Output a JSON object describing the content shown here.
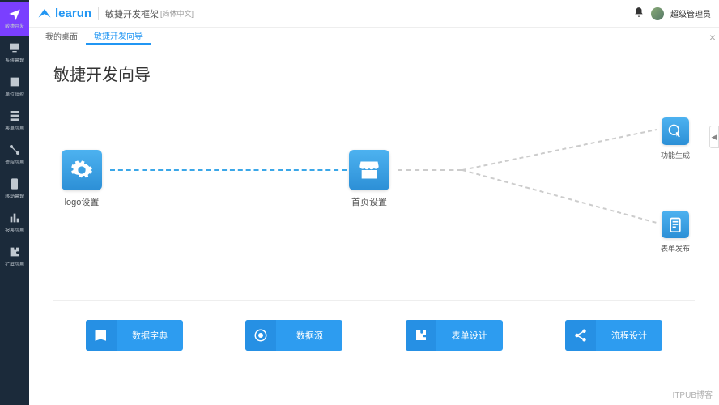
{
  "brand": "learun",
  "app_title": "敏捷开发框架",
  "app_sub": "[简体中文]",
  "user_name": "超级管理员",
  "sidebar": {
    "items": [
      {
        "label": "敏捷开发",
        "icon": "plane",
        "active": true
      },
      {
        "label": "系统管理",
        "icon": "monitor"
      },
      {
        "label": "单位组织",
        "icon": "badge"
      },
      {
        "label": "表单应用",
        "icon": "form"
      },
      {
        "label": "流程应用",
        "icon": "flow"
      },
      {
        "label": "移动管理",
        "icon": "mobile"
      },
      {
        "label": "报表应用",
        "icon": "chart"
      },
      {
        "label": "扩展应用",
        "icon": "puzzle"
      }
    ]
  },
  "tabs": [
    {
      "label": "我的桌面",
      "active": false
    },
    {
      "label": "敏捷开发向导",
      "active": true
    }
  ],
  "page_title": "敏捷开发向导",
  "flow": {
    "node1": {
      "label": "logo设置"
    },
    "node2": {
      "label": "首页设置"
    },
    "node3": {
      "label": "功能生成"
    },
    "node4": {
      "label": "表单发布"
    }
  },
  "actions": [
    {
      "label": "数据字典",
      "icon": "book"
    },
    {
      "label": "数据源",
      "icon": "target"
    },
    {
      "label": "表单设计",
      "icon": "puzzle"
    },
    {
      "label": "流程设计",
      "icon": "share"
    }
  ],
  "watermark": "ITPUB博客"
}
